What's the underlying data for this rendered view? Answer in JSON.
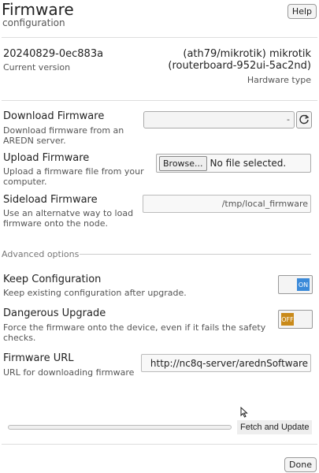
{
  "header": {
    "title": "Firmware",
    "subtitle": "configuration",
    "help_label": "Help"
  },
  "version": {
    "value": "20240829-0ec883a",
    "label": "Current version"
  },
  "hardware": {
    "line1": "(ath79/mikrotik) mikrotik",
    "line2": "(routerboard-952ui-5ac2nd)",
    "label": "Hardware type"
  },
  "download": {
    "title": "Download Firmware",
    "desc": "Download firmware from an AREDN server.",
    "select_value": "",
    "caret": "-",
    "refresh_icon": "refresh-icon"
  },
  "upload": {
    "title": "Upload Firmware",
    "desc": "Upload a firmware file from your computer.",
    "browse_label": "Browse...",
    "file_status": "No file selected."
  },
  "sideload": {
    "title": "Sideload Firmware",
    "desc": "Use an alternatve way to load firmware onto the node.",
    "value": "/tmp/local_firmware"
  },
  "advanced": {
    "label": "Advanced options"
  },
  "keep_config": {
    "title": "Keep Configuration",
    "desc": "Keep existing configuration after upgrade.",
    "state": "ON"
  },
  "dangerous": {
    "title": "Dangerous Upgrade",
    "desc": "Force the firmware onto the device, even if it fails the safety checks.",
    "state": "OFF"
  },
  "firmware_url": {
    "title": "Firmware URL",
    "desc": "URL for downloading firmware",
    "value": "http://nc8q-server/arednSoftware"
  },
  "progress": {
    "percent": 0,
    "fetch_label": "Fetch and Update"
  },
  "footer": {
    "done_label": "Done"
  },
  "colors": {
    "accent": "#3b8ad9",
    "warning": "#c98a1a"
  }
}
